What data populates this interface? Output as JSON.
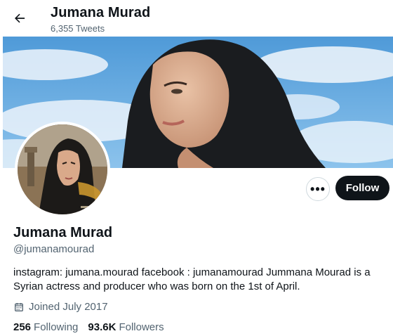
{
  "header": {
    "title": "Jumana Murad",
    "tweet_count": "6,355 Tweets"
  },
  "profile": {
    "name": "Jumana Murad",
    "handle": "@jumanamourad",
    "bio": "instagram: jumana.mourad facebook : jumanamourad Jummana Mourad is a Syrian actress and producer who was born on the 1st of April.",
    "joined": "Joined July 2017",
    "following_count": "256",
    "following_label": "Following",
    "followers_count": "93.6K",
    "followers_label": "Followers"
  },
  "actions": {
    "more_label": "•••",
    "follow_label": "Follow"
  },
  "icons": {
    "back": "back-arrow-icon",
    "calendar": "calendar-icon"
  },
  "colors": {
    "primary_text": "#0f1419",
    "secondary_text": "#536471",
    "follow_button": "#0f1419",
    "banner_sky": "#5aa2dc"
  }
}
